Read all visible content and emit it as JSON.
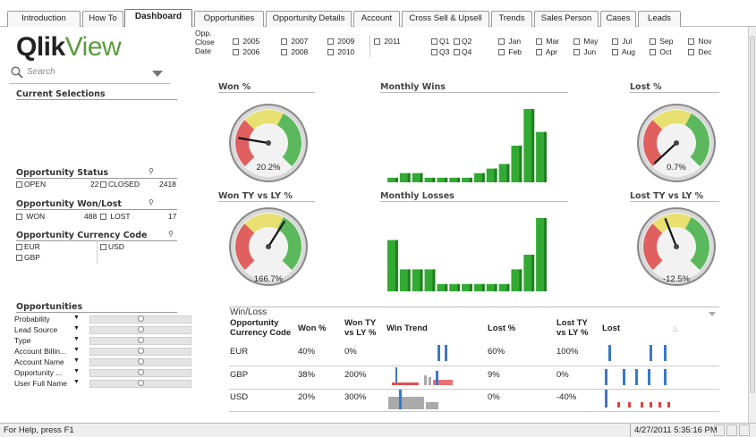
{
  "tabs": [
    "Introduction",
    "How To",
    "Dashboard",
    "Opportunities",
    "Opportunity Details",
    "Account",
    "Cross Sell & Upsell",
    "Trends",
    "Sales Person",
    "Cases",
    "Leads"
  ],
  "active_tab": "Dashboard",
  "logo": {
    "part1": "Qlik",
    "part2": "View"
  },
  "search": {
    "placeholder": "Search"
  },
  "current_selections": {
    "title": "Current Selections"
  },
  "opportunity_status": {
    "title": "Opportunity Status",
    "open_label": "OPEN",
    "open_count": "22",
    "closed_label": "CLOSED",
    "closed_count": "2418"
  },
  "opportunity_wonlost": {
    "title": "Opportunity Won/Lost",
    "won_label": "WON",
    "won_count": "488",
    "lost_label": "LOST",
    "lost_count": "17"
  },
  "currency_code": {
    "title": "Opportunity Currency Code",
    "items": [
      "EUR",
      "USD",
      "GBP"
    ]
  },
  "opportunities": {
    "title": "Opportunities",
    "filters": [
      "Probability",
      "Lead Source",
      "Type",
      "Account Billin...",
      "Account Name",
      "Opportunity ...",
      "User Full Name"
    ]
  },
  "close_date": {
    "label_lines": [
      "Opp.",
      "Close",
      "Date"
    ],
    "years_row1": [
      "2005",
      "2007",
      "2009",
      "2011"
    ],
    "years_row2": [
      "2006",
      "2008",
      "2010"
    ],
    "quarters_row1": [
      "Q1",
      "Q2"
    ],
    "quarters_row2": [
      "Q3",
      "Q4"
    ],
    "months_row1": [
      "Jan",
      "Mar",
      "May",
      "Jul",
      "Sep",
      "Nov"
    ],
    "months_row2": [
      "Feb",
      "Apr",
      "Jun",
      "Aug",
      "Oct",
      "Dec"
    ]
  },
  "gauges": {
    "won_pct": {
      "title": "Won %",
      "value_label": "20.2%",
      "value": 0.202
    },
    "lost_pct": {
      "title": "Lost %",
      "value_label": "0.7%",
      "value": 0.007
    },
    "won_ty_ly": {
      "title": "Won TY vs LY %",
      "value_label": "166.7%",
      "value": 0.62
    },
    "lost_ty_ly": {
      "title": "Lost TY vs LY %",
      "value_label": "-12.5%",
      "value": 0.42
    }
  },
  "charts": {
    "monthly_wins": {
      "title": "Monthly Wins"
    },
    "monthly_losses": {
      "title": "Monthly Losses"
    }
  },
  "chart_data": [
    {
      "type": "bar",
      "title": "Monthly Wins",
      "values": [
        1,
        2,
        2,
        1,
        1,
        1,
        1,
        2,
        3,
        4,
        8,
        16,
        11
      ],
      "color": "#33aa33"
    },
    {
      "type": "bar",
      "title": "Monthly Losses",
      "values": [
        7,
        3,
        3,
        3,
        1,
        1,
        1,
        1,
        1,
        1,
        3,
        5,
        10
      ],
      "color": "#33aa33"
    }
  ],
  "winloss": {
    "title": "Win/Loss",
    "headers": [
      "Opportunity Currency Code",
      "Won %",
      "Won TY vs LY %",
      "Win Trend",
      "Lost %",
      "Lost TY vs LY %",
      "Lost"
    ],
    "rows": [
      {
        "code": "EUR",
        "won_pct": "40%",
        "won_ty": "0%",
        "lost_pct": "60%",
        "lost_ty": "100%"
      },
      {
        "code": "GBP",
        "won_pct": "38%",
        "won_ty": "200%",
        "lost_pct": "9%",
        "lost_ty": "0%"
      },
      {
        "code": "USD",
        "won_pct": "20%",
        "won_ty": "300%",
        "lost_pct": "0%",
        "lost_ty": "-40%"
      }
    ]
  },
  "status": {
    "help": "For Help, press F1",
    "datetime": "4/27/2011 5:35:16 PM"
  },
  "colors": {
    "accent_green": "#33aa33",
    "bar_blue": "#3a78c8",
    "bar_red": "#e04040",
    "logo_green": "#5a9b3c"
  }
}
